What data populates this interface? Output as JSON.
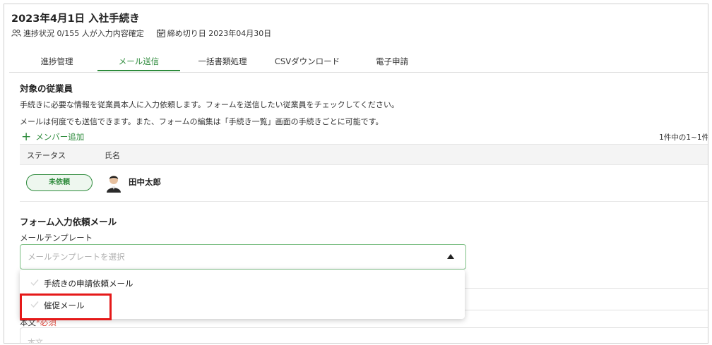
{
  "header": {
    "title": "2023年4月1日 入社手続き",
    "progress_text": "進捗状況 0/155 人が入力内容確定",
    "deadline_text": "締め切り日 2023年04月30日"
  },
  "tabs": [
    {
      "label": "進捗管理"
    },
    {
      "label": "メール送信"
    },
    {
      "label": "一括書類処理"
    },
    {
      "label": "CSVダウンロード"
    },
    {
      "label": "電子申請"
    }
  ],
  "active_tab": "メール送信",
  "employees": {
    "heading": "対象の従業員",
    "desc1": "手続きに必要な情報を従業員本人に入力依頼します。フォームを送信したい従業員をチェックしてください。",
    "desc2": "メールは何度でも送信できます。また、フォームの編集は「手続き一覧」画面の手続きごとに可能です。",
    "add_member": "メンバー追加",
    "count_text": "1件中の1~1件",
    "columns": {
      "status": "ステータス",
      "name": "氏名"
    },
    "rows": [
      {
        "status": "未依頼",
        "name": "田中太郎"
      }
    ]
  },
  "mail": {
    "heading": "フォーム入力依頼メール",
    "template_label": "メールテンプレート",
    "template_placeholder": "メールテンプレートを選択",
    "options": [
      {
        "label": "手続きの申請依頼メール"
      },
      {
        "label": "催促メール"
      }
    ],
    "body_label": "本文",
    "body_required": "*必須",
    "body_placeholder": "本文"
  },
  "colors": {
    "accent": "#2e8b3c",
    "highlight": "#e51919",
    "required": "#e0554a"
  }
}
